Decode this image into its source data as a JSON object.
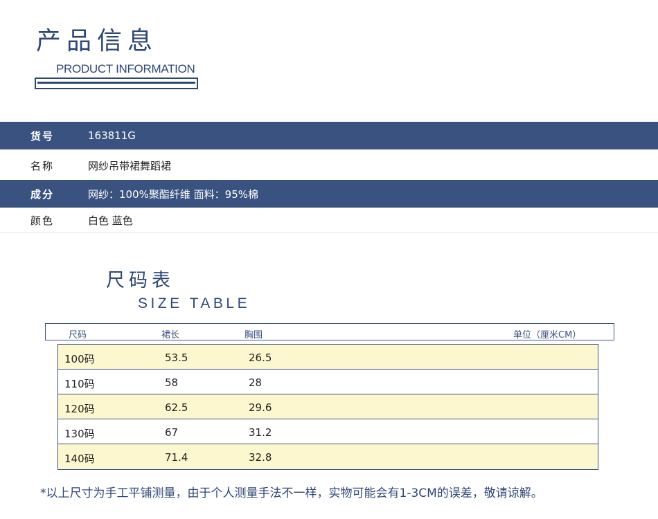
{
  "header": {
    "title_cn": "产品信息",
    "title_en": "PRODUCT INFORMATION"
  },
  "info": [
    {
      "label": "货号",
      "value": "163811G"
    },
    {
      "label": "名称",
      "value": "网纱吊带裙舞蹈裙"
    },
    {
      "label": "成分",
      "value": "网纱：100%聚酯纤维  面料：95%棉"
    },
    {
      "label": "颜色",
      "value": "白色  蓝色"
    }
  ],
  "size_table": {
    "title_cn": "尺码表",
    "title_en": "SIZE TABLE",
    "columns": [
      "尺码",
      "裙长",
      "胸围"
    ],
    "unit": "单位（厘米CM）",
    "rows": [
      [
        "100码",
        "53.5",
        "26.5"
      ],
      [
        "110码",
        "58",
        "28"
      ],
      [
        "120码",
        "62.5",
        "29.6"
      ],
      [
        "130码",
        "67",
        "31.2"
      ],
      [
        "140码",
        "71.4",
        "32.8"
      ]
    ]
  },
  "footnote": "*以上尺寸为手工平铺测量，由于个人测量手法不一样，实物可能会有1-3CM的误差，敬请谅解。",
  "colors": {
    "brand_navy": "#3a5280",
    "row_highlight": "#fdf7cf"
  }
}
